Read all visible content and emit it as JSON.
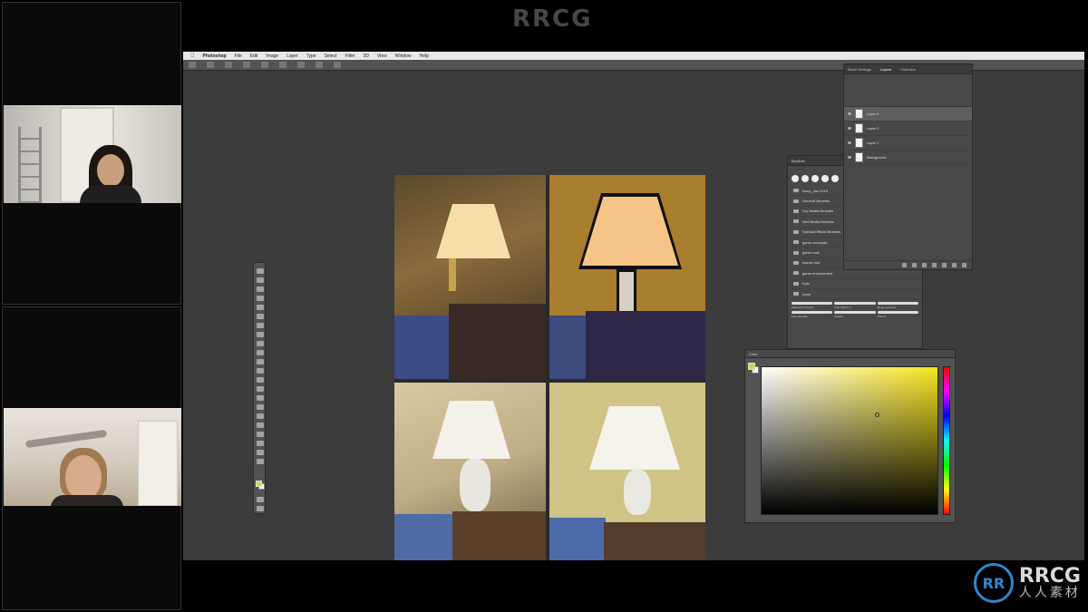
{
  "watermark": {
    "top": "RRCG"
  },
  "logo": {
    "line1": "RRCG",
    "line2": "人人素材",
    "mark": "RR"
  },
  "photoshop": {
    "menubar": {
      "app_name": "Photoshop",
      "menus": [
        "File",
        "Edit",
        "Image",
        "Layer",
        "Type",
        "Select",
        "Filter",
        "3D",
        "View",
        "Window",
        "Help"
      ]
    },
    "layers_panel": {
      "tabs": [
        "Brush Settings",
        "Layers",
        "Channels"
      ],
      "layers": [
        {
          "name": "Layer 3",
          "selected": true
        },
        {
          "name": "Layer 2",
          "selected": false
        },
        {
          "name": "Layer 1",
          "selected": false
        },
        {
          "name": "Background",
          "selected": false
        }
      ]
    },
    "brushes_panel": {
      "title": "Brushes",
      "folders": [
        "Duny_Jan 2019",
        "General Brushes",
        "Dry Media Brushes",
        "Wet Media Brushes",
        "Special Effects Brushes",
        "game concepts",
        "game rock",
        "nature tool",
        "game environment",
        "Kyle",
        "Anne"
      ],
      "stroke_labels": [
        "Watercolor Round",
        "Kyle Marker 1",
        "Mega Gouache",
        "Kyle Sampler",
        "Spatter",
        "Round"
      ]
    },
    "color_panel": {
      "title": "Color",
      "foreground": "#d9d24a",
      "background": "#ffffff",
      "hue_hex": "#f7e51f"
    }
  }
}
